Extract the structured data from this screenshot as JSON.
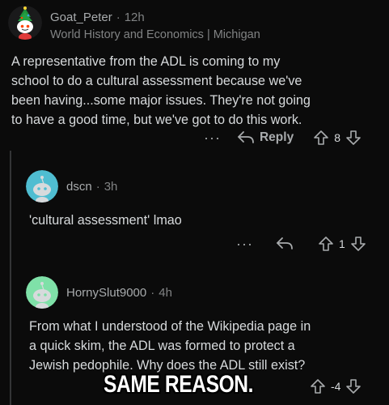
{
  "comments": [
    {
      "username": "Goat_Peter",
      "separator": "·",
      "age": "12h",
      "flair": "World History and Economics | Michigan",
      "body": "A representative from the ADL is coming to my\nschool to do a cultural assessment because we've\nbeen having...some major issues. They're not going\nto have a good time, but we've got to do this work.",
      "more": "···",
      "reply_label": "Reply",
      "score": "8",
      "avatar_color": "#ffffff"
    },
    {
      "username": "dscn",
      "separator": "·",
      "age": "3h",
      "body": "'cultural assessment' lmao",
      "more": "···",
      "score": "1",
      "avatar_color": "#4fbdd1"
    },
    {
      "username": "HornySlut9000",
      "separator": "·",
      "age": "4h",
      "body": "From what I understood of the Wikipedia page in\na quick skim, the ADL was formed to protect a\nJewish pedophile. Why does the ADL still exist?",
      "score": "-4",
      "avatar_color": "#7fe1a8"
    }
  ],
  "caption": "SAME REASON.",
  "colors": {
    "background": "#0b0b0b",
    "text": "#d7dadc",
    "meta": "#818384",
    "thread_line": "#343536"
  },
  "icons": [
    "snoo-avatar-icon",
    "reply-arrow-icon",
    "upvote-icon",
    "downvote-icon",
    "more-options-icon"
  ]
}
